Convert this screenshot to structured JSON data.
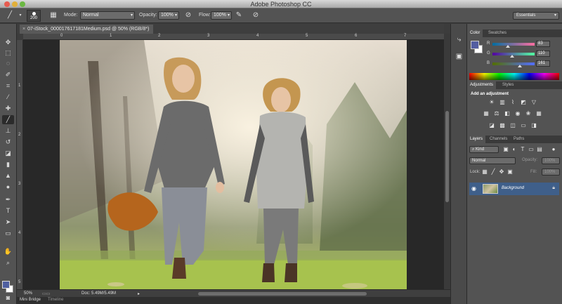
{
  "window": {
    "title": "Adobe Photoshop CC"
  },
  "options_bar": {
    "brush_size": "200",
    "mode_label": "Mode:",
    "mode_value": "Normal",
    "opacity_label": "Opacity:",
    "opacity_value": "100%",
    "flow_label": "Flow:",
    "flow_value": "100%",
    "workspace": "Essentials"
  },
  "document": {
    "tab_title": "07-iStock_000017617181Medium.psd @ 50% (RGB/8*)",
    "close_glyph": "×"
  },
  "ruler": {
    "h_ticks": [
      "0",
      "1",
      "2",
      "3",
      "4",
      "5",
      "6",
      "7"
    ],
    "v_ticks": [
      "1",
      "2",
      "3",
      "4",
      "5"
    ]
  },
  "status_bar": {
    "zoom": "50%",
    "doc_info": "Doc: 5.49M/5.49M"
  },
  "bottom_tabs": [
    "Mini Bridge",
    "Timeline"
  ],
  "color_panel": {
    "tabs": [
      "Color",
      "Swatches"
    ],
    "fg_color": "#535ea1",
    "bg_color": "#ffffff",
    "channels": [
      {
        "label": "R",
        "value": "83",
        "fraction": 0.33
      },
      {
        "label": "G",
        "value": "110",
        "fraction": 0.43
      },
      {
        "label": "B",
        "value": "161",
        "fraction": 0.63
      }
    ]
  },
  "adjustments_panel": {
    "tabs": [
      "Adjustments",
      "Styles"
    ],
    "heading": "Add an adjustment"
  },
  "layers_panel": {
    "tabs": [
      "Layers",
      "Channels",
      "Paths"
    ],
    "filter": "Kind",
    "blend_mode": "Normal",
    "opacity_label": "Opacity:",
    "opacity_value": "100%",
    "lock_label": "Lock:",
    "fill_label": "Fill:",
    "fill_value": "100%",
    "layers": [
      {
        "name": "Background",
        "locked": true,
        "visible": true
      }
    ]
  }
}
